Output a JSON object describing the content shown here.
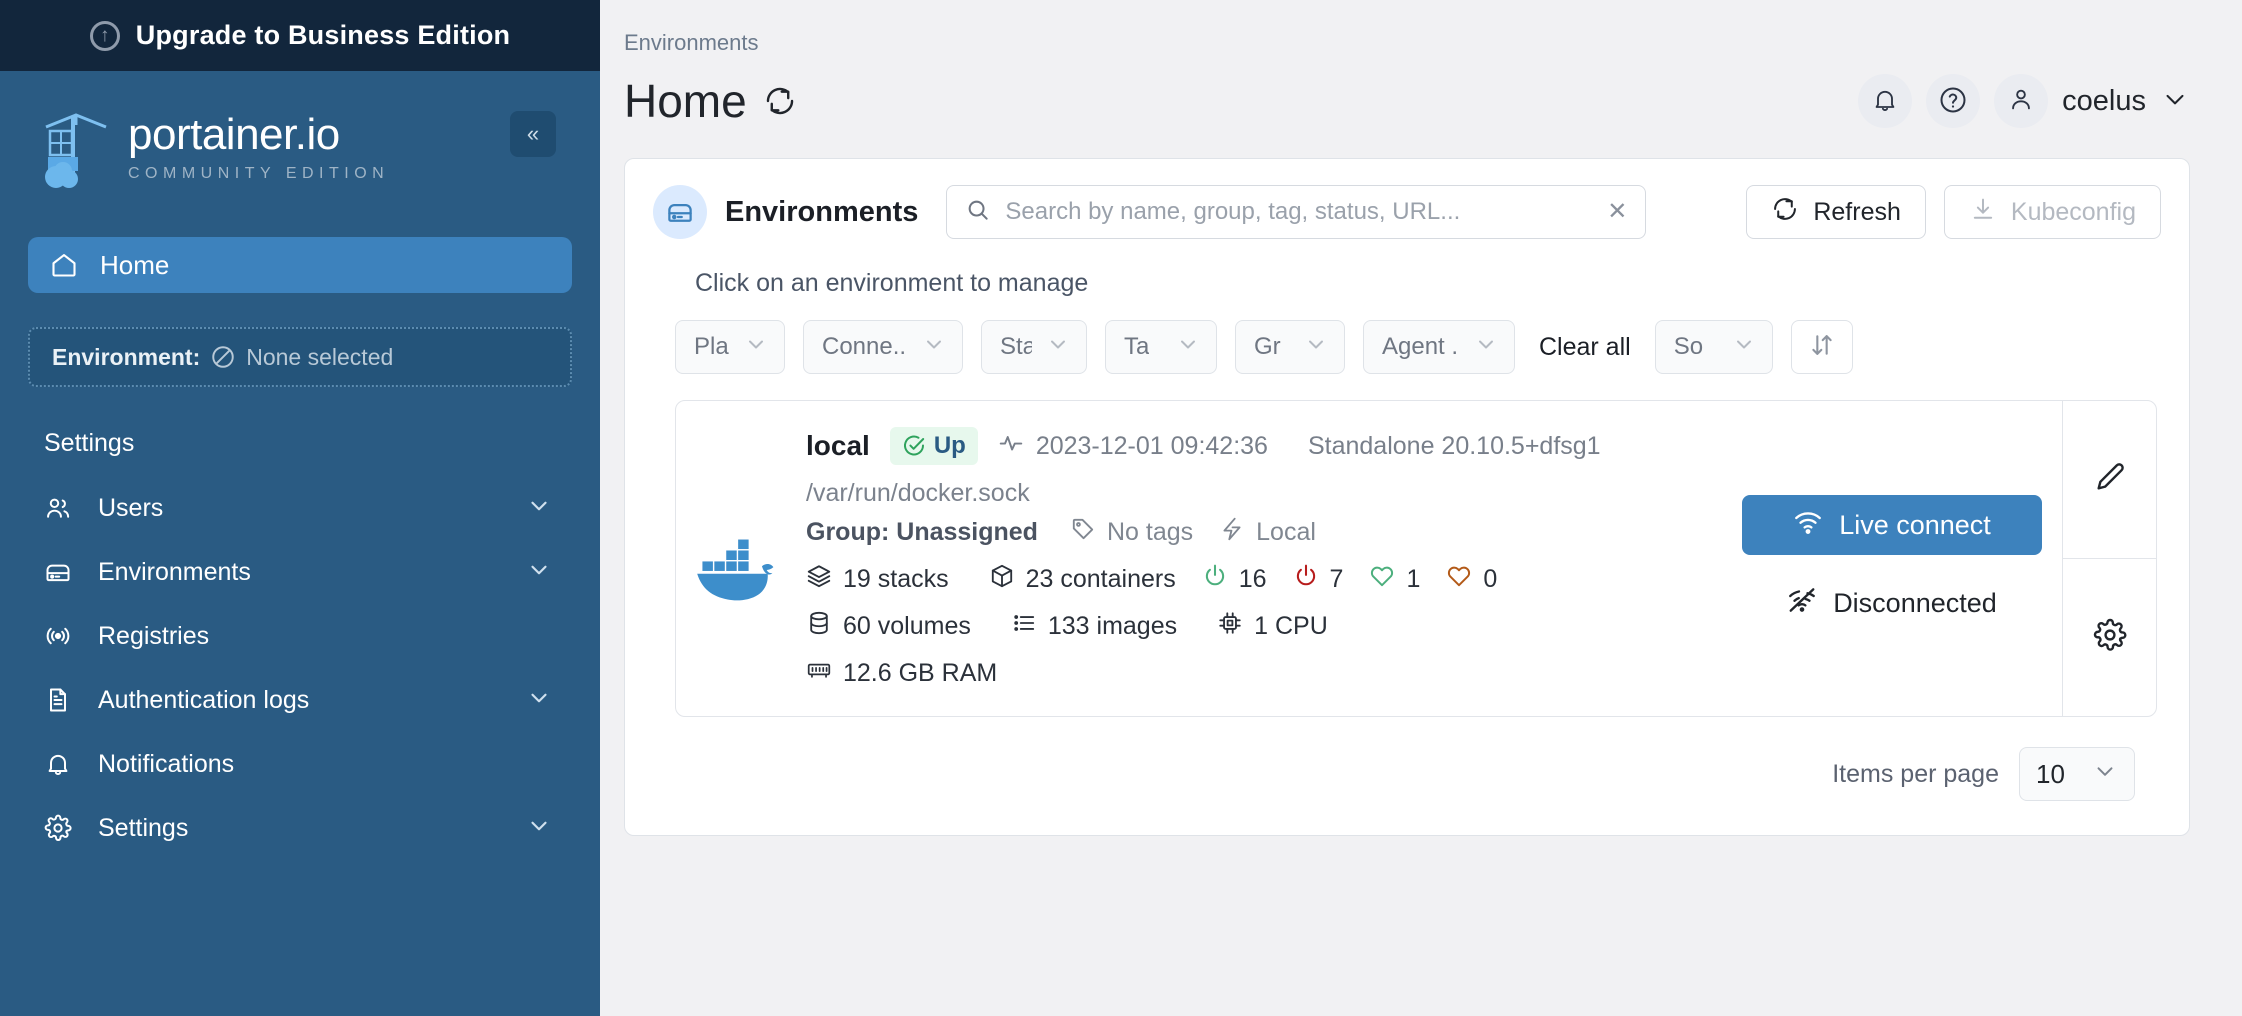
{
  "sidebar": {
    "upgrade_banner": {
      "label": "Upgrade to Business Edition",
      "icon": "arrow-up-circle-icon"
    },
    "logo": {
      "name": "portainer.io",
      "subtitle": "COMMUNITY EDITION"
    },
    "collapse_label": "«",
    "home": {
      "label": "Home",
      "icon": "home-icon"
    },
    "environment_selector": {
      "key": "Environment:",
      "value": "None selected",
      "icon": "none-selected-icon"
    },
    "section_title": "Settings",
    "items": [
      {
        "label": "Users",
        "icon": "users-icon",
        "expandable": true
      },
      {
        "label": "Environments",
        "icon": "environments-icon",
        "expandable": true
      },
      {
        "label": "Registries",
        "icon": "registries-icon",
        "expandable": false
      },
      {
        "label": "Authentication logs",
        "icon": "document-icon",
        "expandable": true
      },
      {
        "label": "Notifications",
        "icon": "bell-icon",
        "expandable": false
      },
      {
        "label": "Settings",
        "icon": "gear-icon",
        "expandable": true
      }
    ]
  },
  "header": {
    "breadcrumb": "Environments",
    "title": "Home",
    "refresh_icon": "refresh-icon",
    "notifications_icon": "bell-icon",
    "help_icon": "question-circle-icon",
    "avatar_icon": "user-icon",
    "user_name": "coelus",
    "user_chevron": "chevron-down-icon"
  },
  "environments_card": {
    "icon": "environments-icon",
    "title": "Environments",
    "search": {
      "placeholder": "Search by name, group, tag, status, URL...",
      "value": "",
      "icon": "search-icon",
      "clear_icon": "close-icon"
    },
    "refresh_button": {
      "label": "Refresh",
      "icon": "refresh-icon"
    },
    "kubeconfig_button": {
      "label": "Kubeconfig",
      "icon": "download-icon",
      "disabled": true
    },
    "hint": "Click on an environment to manage",
    "filters": [
      {
        "label": "Pla",
        "full": "Platform"
      },
      {
        "label": "Conne...",
        "full": "Connection"
      },
      {
        "label": "Sta",
        "full": "Status"
      },
      {
        "label": "Ta",
        "full": "Tags"
      },
      {
        "label": "Gr",
        "full": "Group"
      },
      {
        "label": "Agent ...",
        "full": "Agent version"
      }
    ],
    "clear_all": "Clear all",
    "sort_filter": {
      "label": "So",
      "full": "Sort"
    },
    "sort_direction_icon": "sort-updown-icon",
    "pagination": {
      "label": "Items per page",
      "value": "10",
      "chevron": "chevron-down-icon"
    }
  },
  "environment": {
    "name": "local",
    "status_badge": {
      "label": "Up",
      "icon": "check-circle-icon"
    },
    "heartbeat_icon": "activity-icon",
    "last_check": "2023-12-01 09:42:36",
    "engine": "Standalone 20.10.5+dfsg1",
    "url": "/var/run/docker.sock",
    "platform_icon": "docker-icon",
    "group": "Group: Unassigned",
    "tags": {
      "label": "No tags",
      "icon": "tag-icon"
    },
    "connection": {
      "label": "Local",
      "icon": "bolt-icon"
    },
    "stats": {
      "stacks": {
        "value": "19 stacks",
        "icon": "stacks-icon"
      },
      "containers": {
        "value": "23 containers",
        "icon": "cube-icon"
      },
      "running": {
        "value": "16",
        "icon": "power-icon",
        "color": "#4caf7d"
      },
      "stopped": {
        "value": "7",
        "icon": "power-icon",
        "color": "#b71c1c"
      },
      "healthy": {
        "value": "1",
        "icon": "heart-icon",
        "color": "#4caf7d"
      },
      "unhealthy": {
        "value": "0",
        "icon": "heart-icon",
        "color": "#b35a18"
      },
      "volumes": {
        "value": "60 volumes",
        "icon": "database-icon"
      },
      "images": {
        "value": "133 images",
        "icon": "list-icon"
      },
      "cpu": {
        "value": "1 CPU",
        "icon": "cpu-icon"
      },
      "ram": {
        "value": "12.6 GB RAM",
        "icon": "ram-icon"
      }
    },
    "live_connect": {
      "label": "Live connect",
      "icon": "wifi-icon"
    },
    "connection_status": {
      "label": "Disconnected",
      "icon": "wifi-off-icon"
    },
    "actions": [
      {
        "name": "edit",
        "icon": "pencil-icon"
      },
      {
        "name": "settings",
        "icon": "gear-icon"
      }
    ]
  },
  "colors": {
    "sidebar_bg": "#2a5b83",
    "banner_bg": "#12263c",
    "accent": "#3d82bd",
    "up_green": "#2fa35d",
    "page_bg": "#f1f1f3"
  }
}
